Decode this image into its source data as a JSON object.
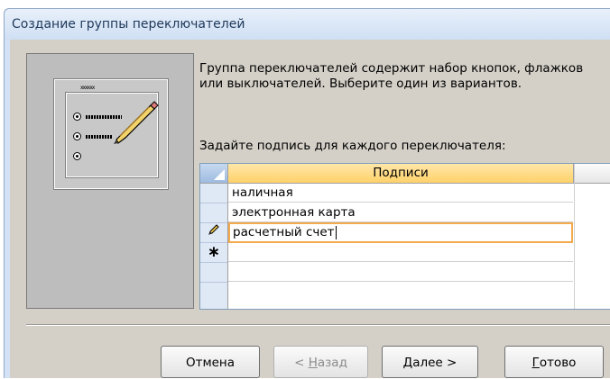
{
  "window": {
    "title": "Создание группы переключателей"
  },
  "description": "Группа переключателей содержит набор кнопок, флажков или выключателей. Выберите один из вариантов.",
  "prompt": "Задайте подпись для каждого переключателя:",
  "grid": {
    "column_header": "Подписи",
    "rows": [
      "наличная",
      "электронная карта",
      "расчетный счет",
      ""
    ],
    "active_row_index": 2,
    "row_markers": [
      "",
      "",
      "pencil-icon",
      "new-row-icon"
    ]
  },
  "buttons": {
    "cancel": "Отмена",
    "back_prefix": "< ",
    "back_access": "Н",
    "back_rest": "азад",
    "next_access": "Д",
    "next_rest": "алее >",
    "finish_access": "Г",
    "finish_rest": "отово"
  },
  "colors": {
    "header_highlight": "#ffd16a",
    "active_row_border": "#f3a94d",
    "title_text": "#1e395b"
  }
}
